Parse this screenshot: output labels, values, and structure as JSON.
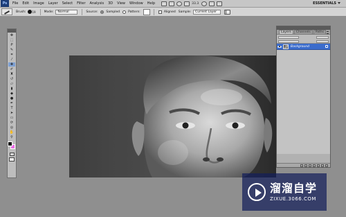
{
  "app": {
    "logo_text": "Ps"
  },
  "menubar": {
    "items": [
      "File",
      "Edit",
      "Image",
      "Layer",
      "Select",
      "Filter",
      "Analysis",
      "3D",
      "View",
      "Window",
      "Help"
    ],
    "zoom": "33.3",
    "workspace": "ESSENTIALS"
  },
  "options": {
    "brush_label": "Brush:",
    "brush_size": "19",
    "mode_label": "Mode:",
    "mode_value": "Normal",
    "source_label": "Source:",
    "sampled_label": "Sampled",
    "pattern_label": "Pattern:",
    "aligned_label": "Aligned",
    "sample_label": "Sample:",
    "sample_value": "Current Layer"
  },
  "tools": {
    "items": [
      "move-tool",
      "marquee-tool",
      "lasso-tool",
      "quick-select-tool",
      "crop-tool",
      "eyedropper-tool",
      "healing-brush-tool",
      "brush-tool",
      "clone-stamp-tool",
      "history-brush-tool",
      "eraser-tool",
      "gradient-tool",
      "blur-tool",
      "dodge-tool",
      "pen-tool",
      "type-tool",
      "path-select-tool",
      "shape-tool",
      "3d-rotate-tool",
      "3d-orbit-tool",
      "hand-tool",
      "zoom-tool"
    ],
    "active_index": 6,
    "foreground_color": "#121212",
    "background_color": "#e96de4"
  },
  "layers_panel": {
    "tabs": [
      "Layers",
      "Channels",
      "Paths"
    ],
    "layer_name": "Background"
  },
  "watermark": {
    "title": "溜溜自学",
    "url": "ZIXUE.3066.COM"
  },
  "colors": {
    "accent": "#3b6ccc",
    "chrome": "#c6c6c6"
  }
}
